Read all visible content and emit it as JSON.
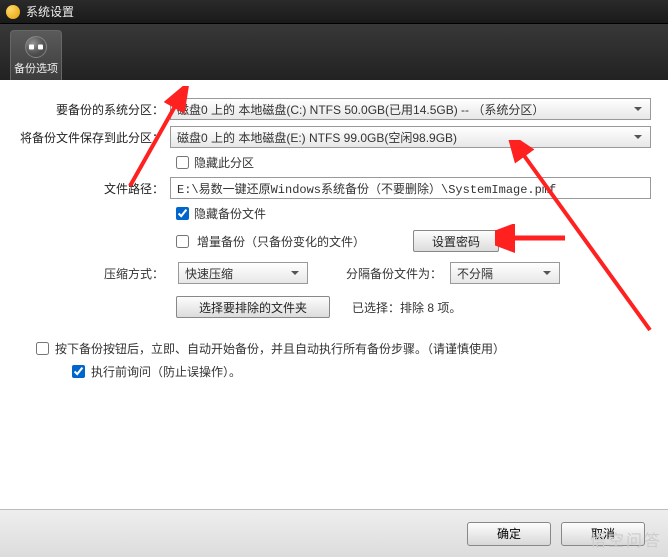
{
  "window": {
    "title": "系统设置"
  },
  "tab": {
    "label": "备份选项"
  },
  "source": {
    "label": "要备份的系统分区：",
    "value": "磁盘0 上的 本地磁盘(C:) NTFS 50.0GB(已用14.5GB) -- （系统分区）"
  },
  "dest": {
    "label": "将备份文件保存到此分区：",
    "value": "磁盘0 上的 本地磁盘(E:) NTFS 99.0GB(空闲98.9GB)"
  },
  "hide_partition": {
    "label": "隐藏此分区"
  },
  "path": {
    "label": "文件路径：",
    "value": "E:\\易数一键还原Windows系统备份（不要删除）\\SystemImage.pmf"
  },
  "hide_file": {
    "label": "隐藏备份文件"
  },
  "incremental": {
    "label": "增量备份（只备份变化的文件）"
  },
  "set_password": {
    "label": "设置密码"
  },
  "compress": {
    "label": "压缩方式：",
    "value": "快速压缩"
  },
  "split": {
    "label": "分隔备份文件为：",
    "value": "不分隔"
  },
  "exclude_btn": {
    "label": "选择要排除的文件夹"
  },
  "exclude_status": "已选择：排除 8 项。",
  "auto_backup": {
    "label": "按下备份按钮后，立即、自动开始备份，并且自动执行所有备份步骤。（请谨慎使用）"
  },
  "confirm_before": {
    "label": "执行前询问（防止误操作）。"
  },
  "buttons": {
    "ok": "确定",
    "cancel": "取消"
  }
}
